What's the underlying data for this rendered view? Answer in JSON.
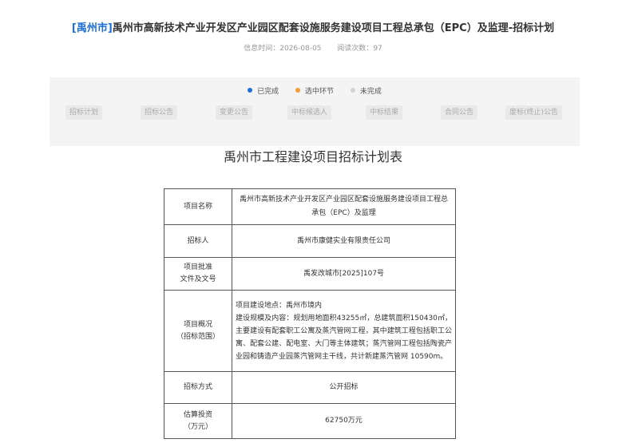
{
  "header": {
    "region_tag": "[禹州市]",
    "title": "禹州市高新技术产业开发区产业园区配套设施服务建设项目工程总承包（EPC）及监理-招标计划",
    "publish_label": "信息时间：",
    "publish_date": "2026-08-05",
    "views_label": "阅读次数：",
    "views_count": "97"
  },
  "progress": {
    "legend": [
      {
        "label": "已完成",
        "color": "#1e6fd8"
      },
      {
        "label": "选中环节",
        "color": "#f39c34"
      },
      {
        "label": "未完成",
        "color": "#d3d3d3"
      }
    ],
    "steps": [
      "招标计划",
      "招标公告",
      "变更公告",
      "中标候选人",
      "中标结果",
      "合同公告",
      "废标(终止)公告"
    ]
  },
  "plan": {
    "heading": "禹州市工程建设项目招标计划表",
    "rows": [
      {
        "label": "项目名称",
        "value": "禹州市高新技术产业开发区产业园区配套设施服务建设项目工程总承包（EPC）及监理"
      },
      {
        "label": "招标人",
        "value": "禹州市康健实业有限责任公司"
      },
      {
        "label_line1": "项目批准",
        "label_line2": "文件及文号",
        "value": "禹发改城市[2025]107号"
      },
      {
        "label_line1": "项目概况",
        "label_line2": "（招标范围）",
        "value_line1": "项目建设地点：禹州市境内",
        "value_line2": "建设规模及内容：规划用地面积43255㎡，总建筑面积150430㎡，主要建设有配套职工公寓及蒸汽管网工程，其中建筑工程包括职工公寓、配套公建、配电室、大门等主体建筑；蒸汽管网工程包括陶瓷产业园和铸造产业园蒸汽管网主干线，共计新建蒸汽管网 10590m。"
      },
      {
        "label": "招标方式",
        "value": "公开招标"
      },
      {
        "label_line1": "估算投资",
        "label_line2": "（万元）",
        "value": "62750万元"
      }
    ]
  }
}
